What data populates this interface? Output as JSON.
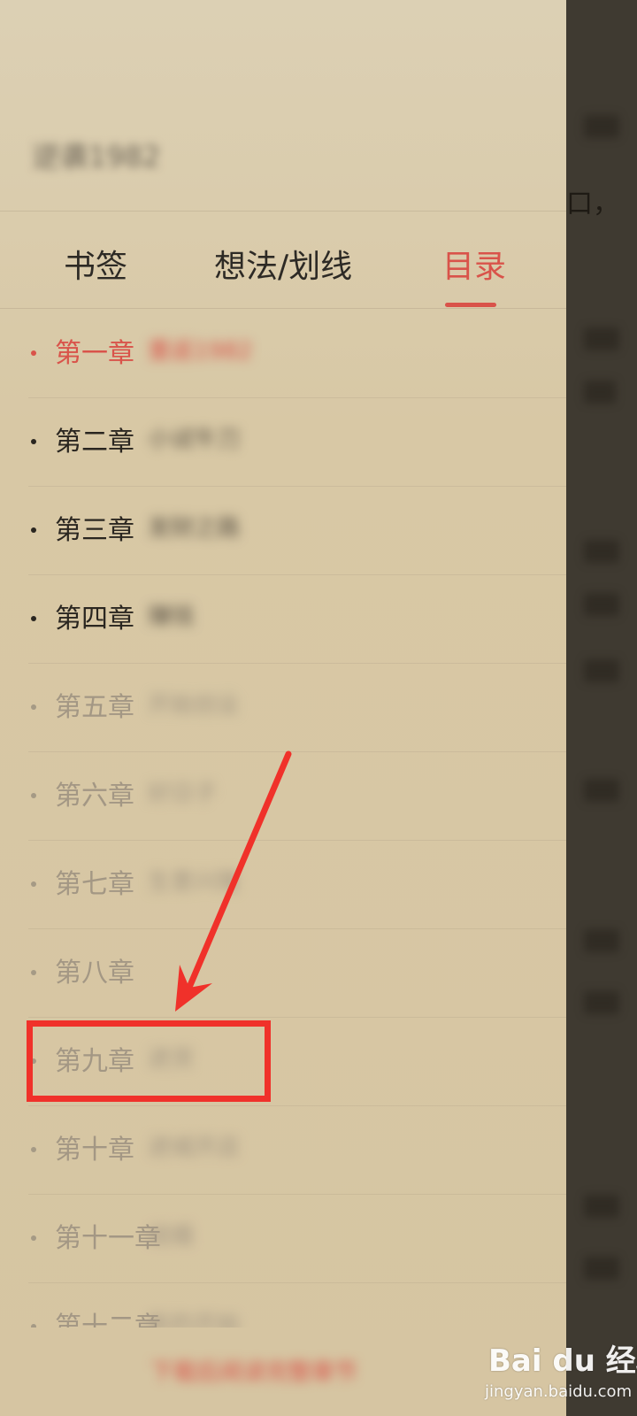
{
  "reader": {
    "edge_char": "口，"
  },
  "drawer": {
    "book_title": "逆袭1982"
  },
  "tabs": [
    {
      "label": "书签",
      "active": false
    },
    {
      "label": "想法/划线",
      "active": false
    },
    {
      "label": "目录",
      "active": true
    }
  ],
  "toc": {
    "items": [
      {
        "label": "第一章",
        "subtitle": "重返1982",
        "state": "current"
      },
      {
        "label": "第二章",
        "subtitle": "小试牛刀",
        "state": "read"
      },
      {
        "label": "第三章",
        "subtitle": "发财之路",
        "state": "read"
      },
      {
        "label": "第四章",
        "subtitle": "赚钱",
        "state": "read"
      },
      {
        "label": "第五章",
        "subtitle": "开始创业",
        "state": "locked"
      },
      {
        "label": "第六章",
        "subtitle": "好日子",
        "state": "locked"
      },
      {
        "label": "第七章",
        "subtitle": "生意兴隆",
        "state": "locked"
      },
      {
        "label": "第八章",
        "subtitle": "",
        "state": "locked"
      },
      {
        "label": "第九章",
        "subtitle": "进货",
        "state": "locked"
      },
      {
        "label": "第十章",
        "subtitle": "进城开店",
        "state": "locked"
      },
      {
        "label": "第十一章",
        "subtitle": "结婚",
        "state": "locked"
      },
      {
        "label": "第十二章",
        "subtitle": "新的开始",
        "state": "locked"
      }
    ]
  },
  "bottom": {
    "text": "下载后阅读完整章节"
  },
  "watermark": {
    "logo": "Bai du 经验",
    "url": "jingyan.baidu.com"
  },
  "colors": {
    "accent": "#d9534a",
    "annotation": "#f0312a",
    "panel_bg": "#d8c8a5",
    "overlay": "#3f3a31"
  }
}
